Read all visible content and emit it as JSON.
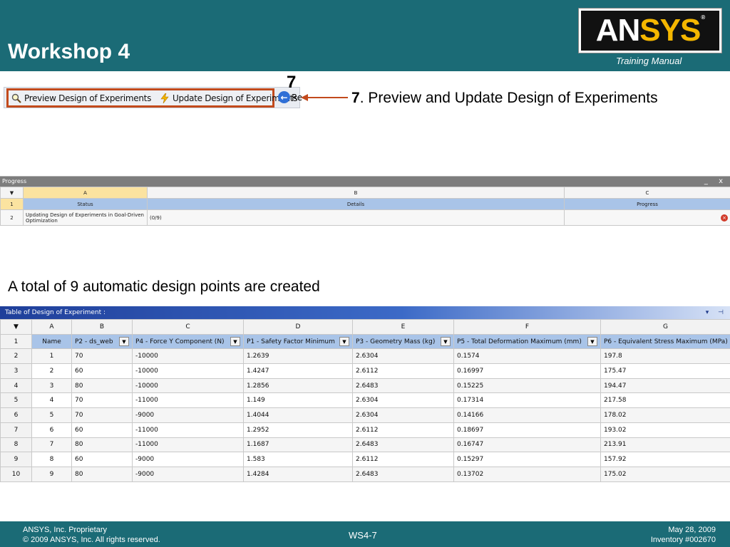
{
  "header": {
    "title": "Workshop 4",
    "logo": {
      "part1": "AN",
      "part2": "SYS",
      "reg": "®"
    },
    "subtitle": "Training Manual",
    "colors": {
      "bar": "#1b6b76",
      "logo_accent": "#f5b700"
    }
  },
  "toolbar": {
    "preview_label": "Preview Design of Experiments",
    "preview_icon": "magnifier-icon",
    "update_label": "Update Design of Experiments",
    "update_icon": "lightning-icon",
    "back_label": "Re",
    "back_icon": "back-arrow-icon",
    "highlight_color": "#c24a1c"
  },
  "callout": {
    "step": "7",
    "number": "7",
    "text": ". Preview and Update Design of Experiments"
  },
  "progress": {
    "title": "Progress",
    "controls": "_ x",
    "columns": [
      "A",
      "B",
      "C"
    ],
    "header_row_num": "1",
    "headers": [
      "Status",
      "Details",
      "Progress"
    ],
    "rows": [
      {
        "num": "2",
        "status": "Updating Design of Experiments in Goal-Driven Optimization",
        "details": "(0/9)",
        "progress": ""
      }
    ]
  },
  "note": "A total of 9 automatic design points are created",
  "doe": {
    "title": "Table of Design of Experiment :",
    "controls": "▾ ⊣",
    "columns": [
      "A",
      "B",
      "C",
      "D",
      "E",
      "F",
      "G"
    ],
    "header_row_num": "1",
    "headers": [
      "Name",
      "P2 - ds_web",
      "P4 - Force Y Component (N)",
      "P1 - Safety Factor Minimum",
      "P3 - Geometry Mass (kg)",
      "P5 - Total Deformation Maximum (mm)",
      "P6 - Equivalent Stress Maximum (MPa)"
    ],
    "rows": [
      {
        "num": "2",
        "cells": [
          "1",
          "70",
          "-10000",
          "1.2639",
          "2.6304",
          "0.1574",
          "197.8"
        ]
      },
      {
        "num": "3",
        "cells": [
          "2",
          "60",
          "-10000",
          "1.4247",
          "2.6112",
          "0.16997",
          "175.47"
        ]
      },
      {
        "num": "4",
        "cells": [
          "3",
          "80",
          "-10000",
          "1.2856",
          "2.6483",
          "0.15225",
          "194.47"
        ]
      },
      {
        "num": "5",
        "cells": [
          "4",
          "70",
          "-11000",
          "1.149",
          "2.6304",
          "0.17314",
          "217.58"
        ]
      },
      {
        "num": "6",
        "cells": [
          "5",
          "70",
          "-9000",
          "1.4044",
          "2.6304",
          "0.14166",
          "178.02"
        ]
      },
      {
        "num": "7",
        "cells": [
          "6",
          "60",
          "-11000",
          "1.2952",
          "2.6112",
          "0.18697",
          "193.02"
        ]
      },
      {
        "num": "8",
        "cells": [
          "7",
          "80",
          "-11000",
          "1.1687",
          "2.6483",
          "0.16747",
          "213.91"
        ]
      },
      {
        "num": "9",
        "cells": [
          "8",
          "60",
          "-9000",
          "1.583",
          "2.6112",
          "0.15297",
          "157.92"
        ]
      },
      {
        "num": "10",
        "cells": [
          "9",
          "80",
          "-9000",
          "1.4284",
          "2.6483",
          "0.13702",
          "175.02"
        ]
      }
    ]
  },
  "chart_data": {
    "type": "table",
    "title": "Table of Design of Experiment :",
    "columns": [
      "Name",
      "P2 - ds_web",
      "P4 - Force Y Component (N)",
      "P1 - Safety Factor Minimum",
      "P3 - Geometry Mass (kg)",
      "P5 - Total Deformation Maximum (mm)",
      "P6 - Equivalent Stress Maximum (MPa)"
    ],
    "rows": [
      [
        1,
        70,
        -10000,
        1.2639,
        2.6304,
        0.1574,
        197.8
      ],
      [
        2,
        60,
        -10000,
        1.4247,
        2.6112,
        0.16997,
        175.47
      ],
      [
        3,
        80,
        -10000,
        1.2856,
        2.6483,
        0.15225,
        194.47
      ],
      [
        4,
        70,
        -11000,
        1.149,
        2.6304,
        0.17314,
        217.58
      ],
      [
        5,
        70,
        -9000,
        1.4044,
        2.6304,
        0.14166,
        178.02
      ],
      [
        6,
        60,
        -11000,
        1.2952,
        2.6112,
        0.18697,
        193.02
      ],
      [
        7,
        80,
        -11000,
        1.1687,
        2.6483,
        0.16747,
        213.91
      ],
      [
        8,
        60,
        -9000,
        1.583,
        2.6112,
        0.15297,
        157.92
      ],
      [
        9,
        80,
        -9000,
        1.4284,
        2.6483,
        0.13702,
        175.02
      ]
    ]
  },
  "footer": {
    "left_line1": "ANSYS, Inc. Proprietary",
    "left_line2": "© 2009 ANSYS, Inc.  All rights reserved.",
    "center": "WS4-7",
    "right_line1": "May 28, 2009",
    "right_line2": "Inventory #002670"
  }
}
